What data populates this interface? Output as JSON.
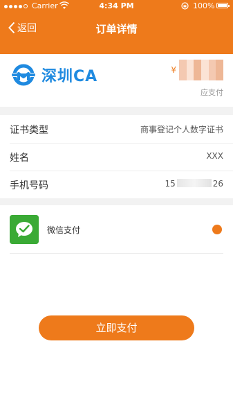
{
  "status_bar": {
    "carrier": "Carrier",
    "time": "4:34 PM",
    "battery": "100%"
  },
  "nav": {
    "back_label": "返回",
    "title": "订单详情"
  },
  "header": {
    "brand": "深圳CA",
    "price_symbol": "¥",
    "pay_label": "应支付"
  },
  "details": [
    {
      "key": "证书类型",
      "value": "商事登记个人数字证书"
    },
    {
      "key": "姓名",
      "value": "XXX"
    },
    {
      "key": "手机号码",
      "value_prefix": "15",
      "value_suffix": "26"
    }
  ],
  "payment": {
    "method_label": "微信支付",
    "selected": true
  },
  "action": {
    "pay_button": "立即支付"
  },
  "colors": {
    "accent": "#ee7a1b",
    "brand_blue": "#1f8ae0",
    "wechat_green": "#3aaa35"
  }
}
